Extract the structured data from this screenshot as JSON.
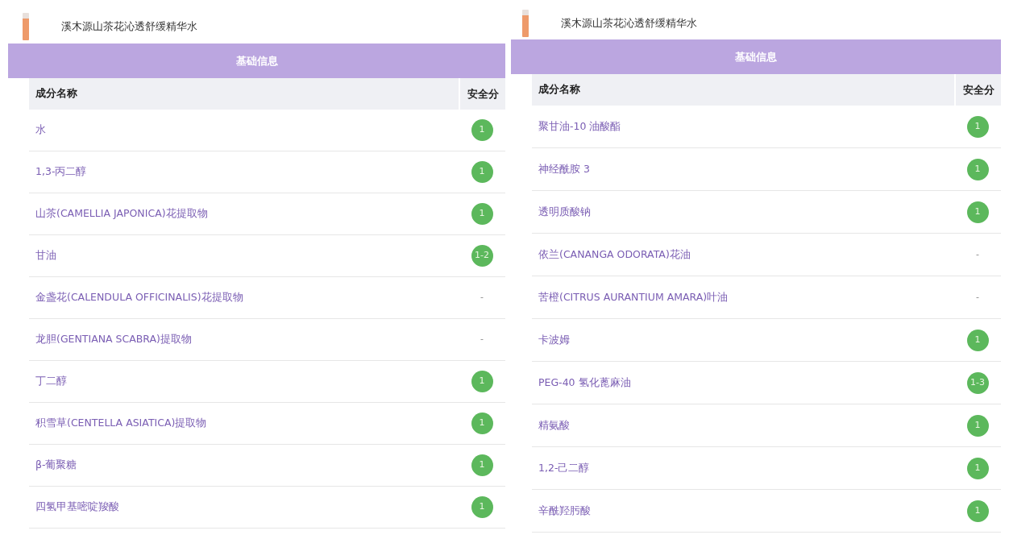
{
  "panels": [
    {
      "product": {
        "title": "溪木源山茶花沁透舒缓精华水"
      },
      "section_title": "基础信息",
      "columns": [
        "成分名称",
        "安全分"
      ],
      "rows": [
        {
          "name": "水",
          "score": "1",
          "kind": "badge"
        },
        {
          "name": "1,3-丙二醇",
          "score": "1",
          "kind": "badge"
        },
        {
          "name": "山茶(CAMELLIA JAPONICA)花提取物",
          "score": "1",
          "kind": "badge"
        },
        {
          "name": "甘油",
          "score": "1-2",
          "kind": "badge"
        },
        {
          "name": "金盏花(CALENDULA OFFICINALIS)花提取物",
          "score": "-",
          "kind": "plain"
        },
        {
          "name": "龙胆(GENTIANA SCABRA)提取物",
          "score": "-",
          "kind": "plain"
        },
        {
          "name": "丁二醇",
          "score": "1",
          "kind": "badge"
        },
        {
          "name": "积雪草(CENTELLA ASIATICA)提取物",
          "score": "1",
          "kind": "badge"
        },
        {
          "name": "β-葡聚糖",
          "score": "1",
          "kind": "badge"
        },
        {
          "name": "四氢甲基嘧啶羧酸",
          "score": "1",
          "kind": "badge"
        }
      ]
    },
    {
      "product": {
        "title": "溪木源山茶花沁透舒缓精华水"
      },
      "section_title": "基础信息",
      "columns": [
        "成分名称",
        "安全分"
      ],
      "rows": [
        {
          "name": "聚甘油-10 油酸酯",
          "score": "1",
          "kind": "badge"
        },
        {
          "name": "神经酰胺 3",
          "score": "1",
          "kind": "badge"
        },
        {
          "name": "透明质酸钠",
          "score": "1",
          "kind": "badge"
        },
        {
          "name": "依兰(CANANGA ODORATA)花油",
          "score": "-",
          "kind": "plain"
        },
        {
          "name": "苦橙(CITRUS AURANTIUM AMARA)叶油",
          "score": "-",
          "kind": "plain"
        },
        {
          "name": "卡波姆",
          "score": "1",
          "kind": "badge"
        },
        {
          "name": "PEG-40 氢化蓖麻油",
          "score": "1-3",
          "kind": "badge"
        },
        {
          "name": "精氨酸",
          "score": "1",
          "kind": "badge"
        },
        {
          "name": "1,2-己二醇",
          "score": "1",
          "kind": "badge"
        },
        {
          "name": "辛酰羟肟酸",
          "score": "1",
          "kind": "badge"
        }
      ]
    }
  ]
}
